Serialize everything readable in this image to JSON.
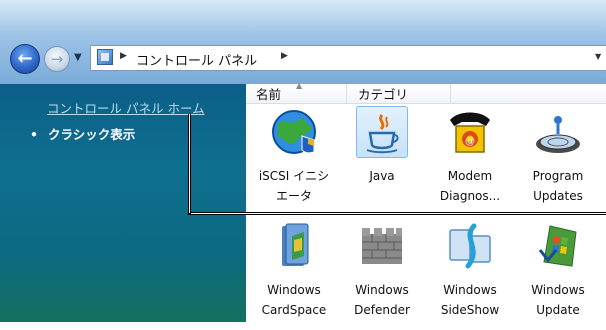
{
  "address_bar": {
    "crumb": "コントロール パネル"
  },
  "left_pane": {
    "home_link": "コントロール パネル ホーム",
    "classic_view": "クラシック表示"
  },
  "columns": {
    "name": "名前",
    "category": "カテゴリ"
  },
  "items": [
    {
      "label": "iSCSI イニシ\nエータ",
      "icon": "iscsi-globe-icon"
    },
    {
      "label": "Java",
      "icon": "java-cup-icon"
    },
    {
      "label": "Modem\nDiagnos...",
      "icon": "modem-phone-icon"
    },
    {
      "label": "Program\nUpdates",
      "icon": "program-updates-icon"
    },
    {
      "label": "Windows\nCardSpace",
      "icon": "cardspace-icon"
    },
    {
      "label": "Windows\nDefender",
      "icon": "defender-wall-icon"
    },
    {
      "label": "Windows\nSideShow",
      "icon": "sideshow-icon"
    },
    {
      "label": "Windows\nUpdate",
      "icon": "windows-update-icon"
    }
  ]
}
